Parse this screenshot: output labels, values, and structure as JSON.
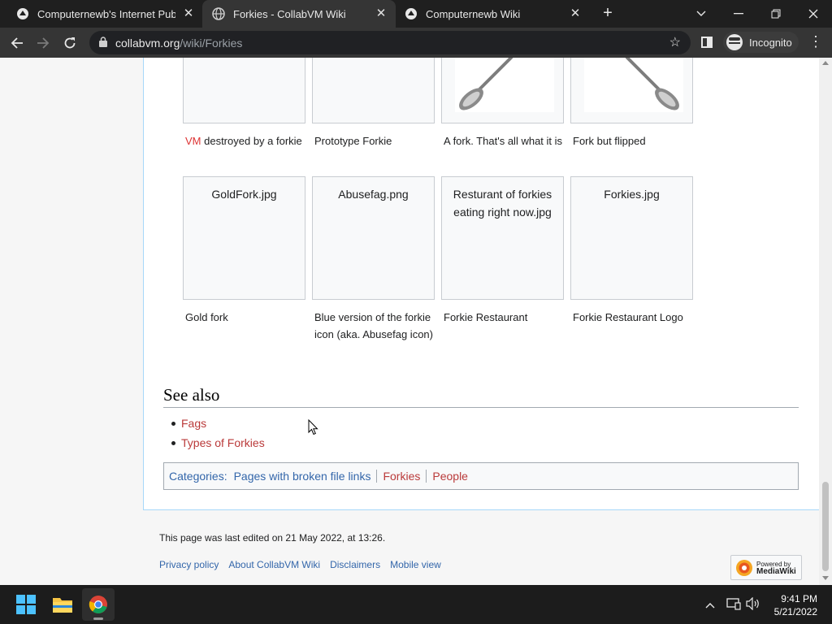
{
  "browser": {
    "tabs": [
      {
        "title": "Computernewb's Internet Pub Hu",
        "active": false
      },
      {
        "title": "Forkies - CollabVM Wiki",
        "active": true
      },
      {
        "title": "Computernewb Wiki",
        "active": false
      }
    ],
    "url_host": "collabvm.org",
    "url_path": "/wiki/Forkies",
    "incognito_label": "Incognito"
  },
  "gallery_top_captions": [
    {
      "prefix": "VM",
      "rest": " destroyed by a forkie"
    },
    {
      "text": "Prototype Forkie"
    },
    {
      "text": "A fork. That's all what it is"
    },
    {
      "text": "Fork but flipped"
    }
  ],
  "gallery_bottom": [
    {
      "filename": "GoldFork.jpg",
      "caption": "Gold fork"
    },
    {
      "filename": "Abusefag.png",
      "caption": "Blue version of the forkie icon (aka. Abusefag icon)"
    },
    {
      "filename": "Resturant of forkies eating right now.jpg",
      "caption": "Forkie Restaurant"
    },
    {
      "filename": "Forkies.jpg",
      "caption": "Forkie Restaurant Logo"
    }
  ],
  "see_also": {
    "heading": "See also",
    "items": [
      "Fags",
      "Types of Forkies"
    ]
  },
  "categories": {
    "label": "Categories",
    "items": [
      "Pages with broken file links",
      "Forkies",
      "People"
    ]
  },
  "footer": {
    "last_edited": "This page was last edited on 21 May 2022, at 13:26.",
    "links": [
      "Privacy policy",
      "About CollabVM Wiki",
      "Disclaimers",
      "Mobile view"
    ],
    "powered_small": "Powered by",
    "powered_big": "MediaWiki"
  },
  "taskbar": {
    "time": "9:41 PM",
    "date": "5/21/2022"
  },
  "colors": {
    "link_blue": "#3366aa",
    "link_red": "#ba3a3a",
    "tab_bg": "#1f1f1f",
    "toolbar_bg": "#353535"
  }
}
